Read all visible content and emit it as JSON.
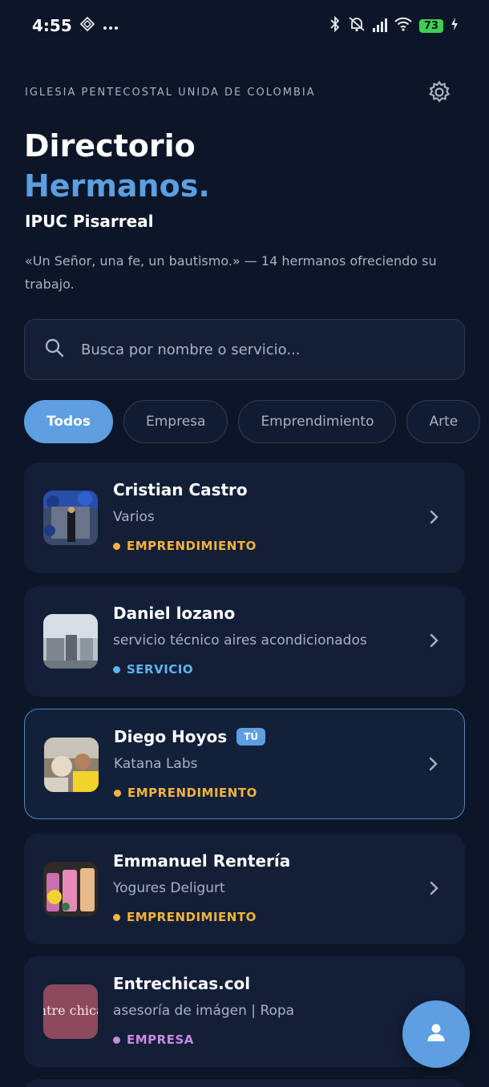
{
  "status_bar": {
    "time": "4:55",
    "battery": "73",
    "left_icons": [
      "nfc-icon",
      "more-dots-icon"
    ],
    "right_icons": [
      "bluetooth-icon",
      "silent-bell-icon",
      "signal-icon",
      "wifi-icon",
      "battery-icon",
      "charging-icon"
    ]
  },
  "header": {
    "org": "IGLESIA PENTECOSTAL UNIDA DE COLOMBIA",
    "title_line1": "Directorio",
    "title_line2": "Hermanos.",
    "subtitle": "IPUC Pisarreal",
    "description": "«Un Señor, una fe, un bautismo.» — 14 hermanos ofreciendo su trabajo."
  },
  "search": {
    "placeholder": "Busca por nombre o servicio..."
  },
  "filters": [
    {
      "label": "Todos",
      "active": true
    },
    {
      "label": "Empresa",
      "active": false
    },
    {
      "label": "Emprendimiento",
      "active": false
    },
    {
      "label": "Arte",
      "active": false
    }
  ],
  "members": [
    {
      "name": "Cristian Castro",
      "service": "Varios",
      "category": "EMPRENDIMIENTO",
      "category_color": "#f2b33d",
      "badge": ""
    },
    {
      "name": "Daniel lozano",
      "service": "servicio técnico aires acondicionados",
      "category": "SERVICIO",
      "category_color": "#5fb3f0",
      "badge": ""
    },
    {
      "name": "Diego Hoyos",
      "service": "Katana Labs",
      "category": "EMPRENDIMIENTO",
      "category_color": "#f2b33d",
      "badge": "TÚ"
    },
    {
      "name": "Emmanuel Rentería",
      "service": "Yogures Deligurt",
      "category": "EMPRENDIMIENTO",
      "category_color": "#f2b33d",
      "badge": ""
    },
    {
      "name": "Entrechicas.col",
      "service": "asesoría de imágen | Ropa",
      "category": "EMPRESA",
      "category_color": "#c98be0",
      "badge": ""
    }
  ],
  "logo_text": "entre chicas",
  "colors": {
    "background": "#0c1628",
    "card": "#131f37",
    "accent": "#5d9fe0"
  }
}
